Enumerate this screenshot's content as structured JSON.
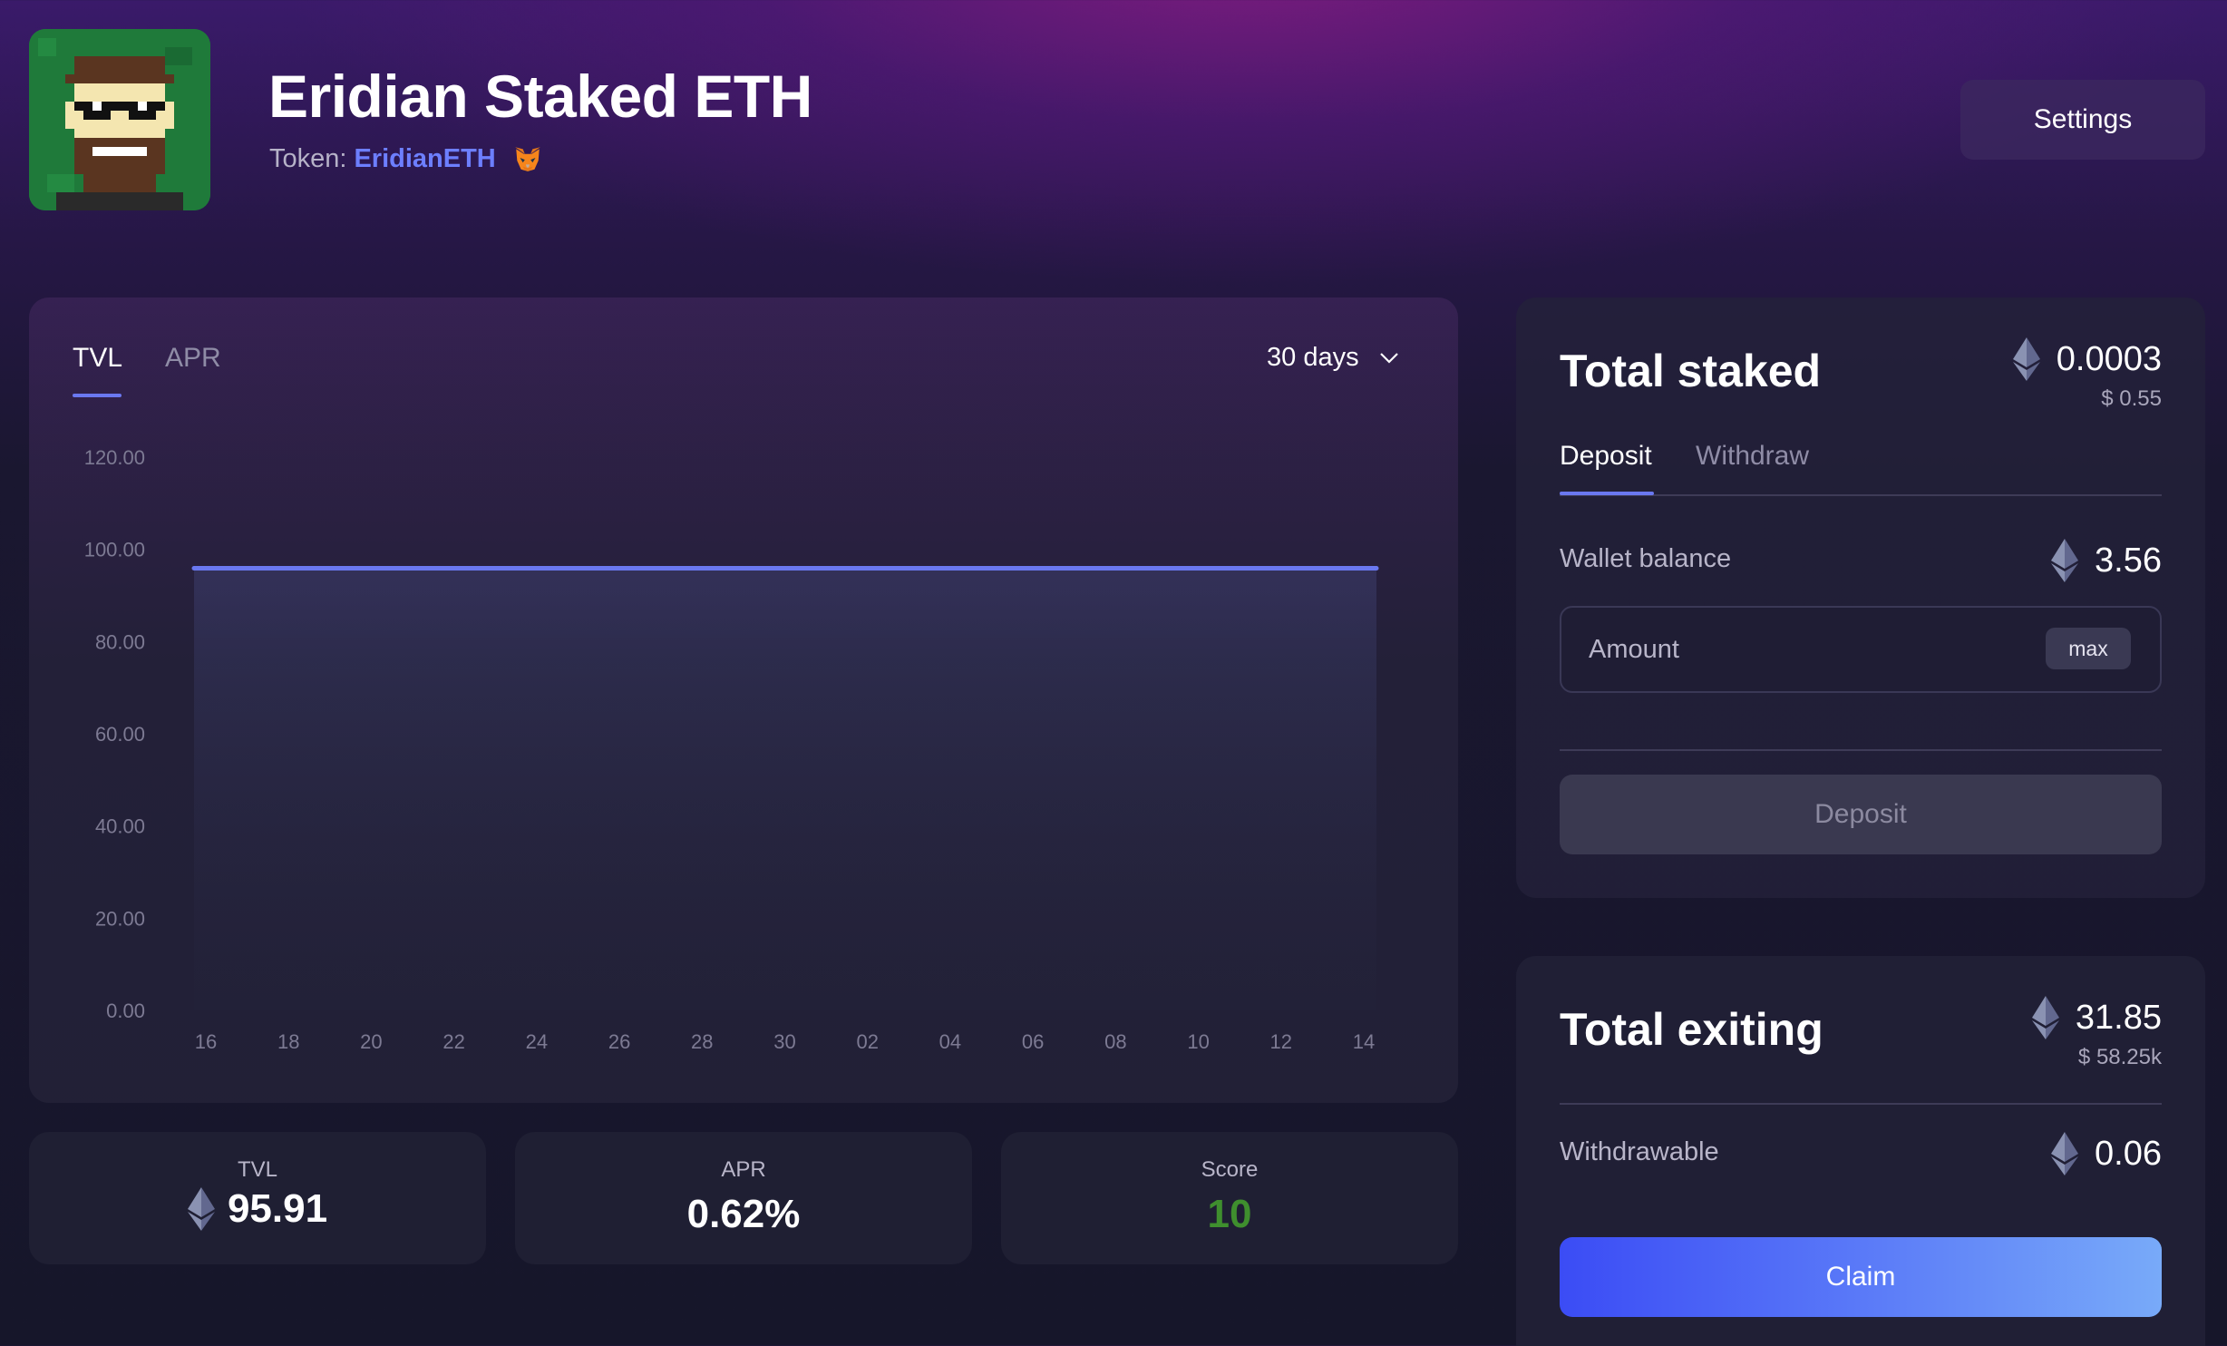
{
  "header": {
    "title": "Eridian Staked ETH",
    "token_prefix": "Token:",
    "token_name": "EridianETH",
    "settings_label": "Settings"
  },
  "icons": {
    "avatar": "pixel-avatar-icon",
    "wallet": "metamask-fox-icon",
    "currency": "ethereum-icon",
    "dropdown": "chevron-down-icon"
  },
  "colors": {
    "accent": "#6a78f0",
    "token_link": "#6d7fff",
    "score": "#3f8f2e",
    "claim_start": "#3b4cf5",
    "claim_end": "#78aaf9"
  },
  "chart_panel": {
    "tabs": [
      {
        "label": "TVL",
        "active": true
      },
      {
        "label": "APR",
        "active": false
      }
    ],
    "period": "30 days"
  },
  "chart_data": {
    "type": "area",
    "series": [
      {
        "values": [
          95.91,
          95.91,
          95.91,
          95.91,
          95.91,
          95.91,
          95.91,
          95.91,
          95.91,
          95.91,
          95.91,
          95.91,
          95.91,
          95.91,
          95.91,
          95.91,
          95.91,
          95.91,
          95.91,
          95.91,
          95.91,
          95.91,
          95.91,
          95.91,
          95.91,
          95.91,
          95.91,
          95.91,
          95.91,
          95.91,
          95.91
        ]
      }
    ],
    "x_tick_labels": [
      "16",
      "18",
      "20",
      "22",
      "24",
      "26",
      "28",
      "30",
      "02",
      "04",
      "06",
      "08",
      "10",
      "12",
      "14"
    ],
    "y_tick_labels": [
      "120.00",
      "100.00",
      "80.00",
      "60.00",
      "40.00",
      "20.00",
      "0.00"
    ],
    "y_ticks": [
      120,
      100,
      80,
      60,
      40,
      20,
      0
    ],
    "ylim": [
      0,
      120
    ],
    "grid": false,
    "line_color": "#6a78f0"
  },
  "stats": [
    {
      "label": "TVL",
      "value": "95.91",
      "icon": "ethereum-icon"
    },
    {
      "label": "APR",
      "value": "0.62%"
    },
    {
      "label": "Score",
      "value": "10"
    }
  ],
  "staked": {
    "title": "Total staked",
    "eth_value": "0.0003",
    "usd_value": "$ 0.55",
    "tabs": [
      {
        "label": "Deposit",
        "active": true
      },
      {
        "label": "Withdraw",
        "active": false
      }
    ],
    "wallet_balance_label": "Wallet balance",
    "wallet_balance_value": "3.56",
    "amount_placeholder": "Amount",
    "max_label": "max",
    "deposit_button_label": "Deposit"
  },
  "exiting": {
    "title": "Total exiting",
    "eth_value": "31.85",
    "usd_value": "$ 58.25k",
    "withdrawable_label": "Withdrawable",
    "withdrawable_value": "0.06",
    "claim_button_label": "Claim"
  }
}
